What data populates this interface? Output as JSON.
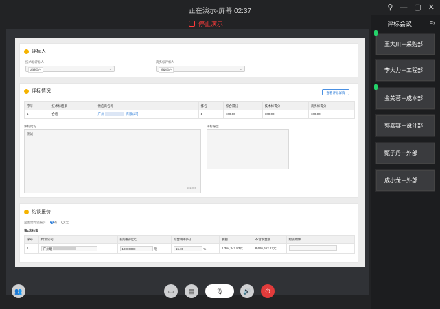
{
  "window": {
    "title": "正在演示-屏幕 02:37",
    "stop_label": "停止演示"
  },
  "section1": {
    "title": "评标人",
    "tech_label": "技术标评标人",
    "biz_label": "商务标评标人",
    "tech_value": "超级用户",
    "biz_value": "超级用户"
  },
  "section2": {
    "title": "评标情况",
    "export_button": "查看评标详情",
    "headers": [
      "序号",
      "技术标结果",
      "供应商名称",
      "排名",
      "综合得分",
      "技术标得分",
      "商务标得分"
    ],
    "row": {
      "no": "1",
      "result": "合格",
      "supplier": "广州",
      "supplier_tail": "有限公司",
      "rank": "1",
      "total": "100.00",
      "tech": "100.00",
      "biz": "100.00"
    },
    "conclusion_label": "评标结论",
    "conclusion_text": "测试",
    "counter": "2/1000",
    "report_label": "评标报告"
  },
  "section3": {
    "title": "约谈报价",
    "question": "是否需约谈报价",
    "yes": "有",
    "no": "无",
    "round": "第1次约谈",
    "headers": [
      "序号",
      "约谈公司",
      "投标报价(元)",
      "综合税率(%)",
      "税额",
      "不含税金额",
      "约谈附件"
    ],
    "row": {
      "no": "1",
      "company": "广州明",
      "price": "10000000",
      "price_unit": "元",
      "rate": "15.00",
      "rate_unit": "%",
      "tax": "1,304,347.83元",
      "net": "8,695,652.17元"
    }
  },
  "panel": {
    "title": "评标会议",
    "members": [
      "王大川－采购部",
      "李大力－工程部",
      "金美蓉－成本部",
      "郭嘉容－设计部",
      "甄子丹－外部",
      "成小龙－外部"
    ]
  }
}
